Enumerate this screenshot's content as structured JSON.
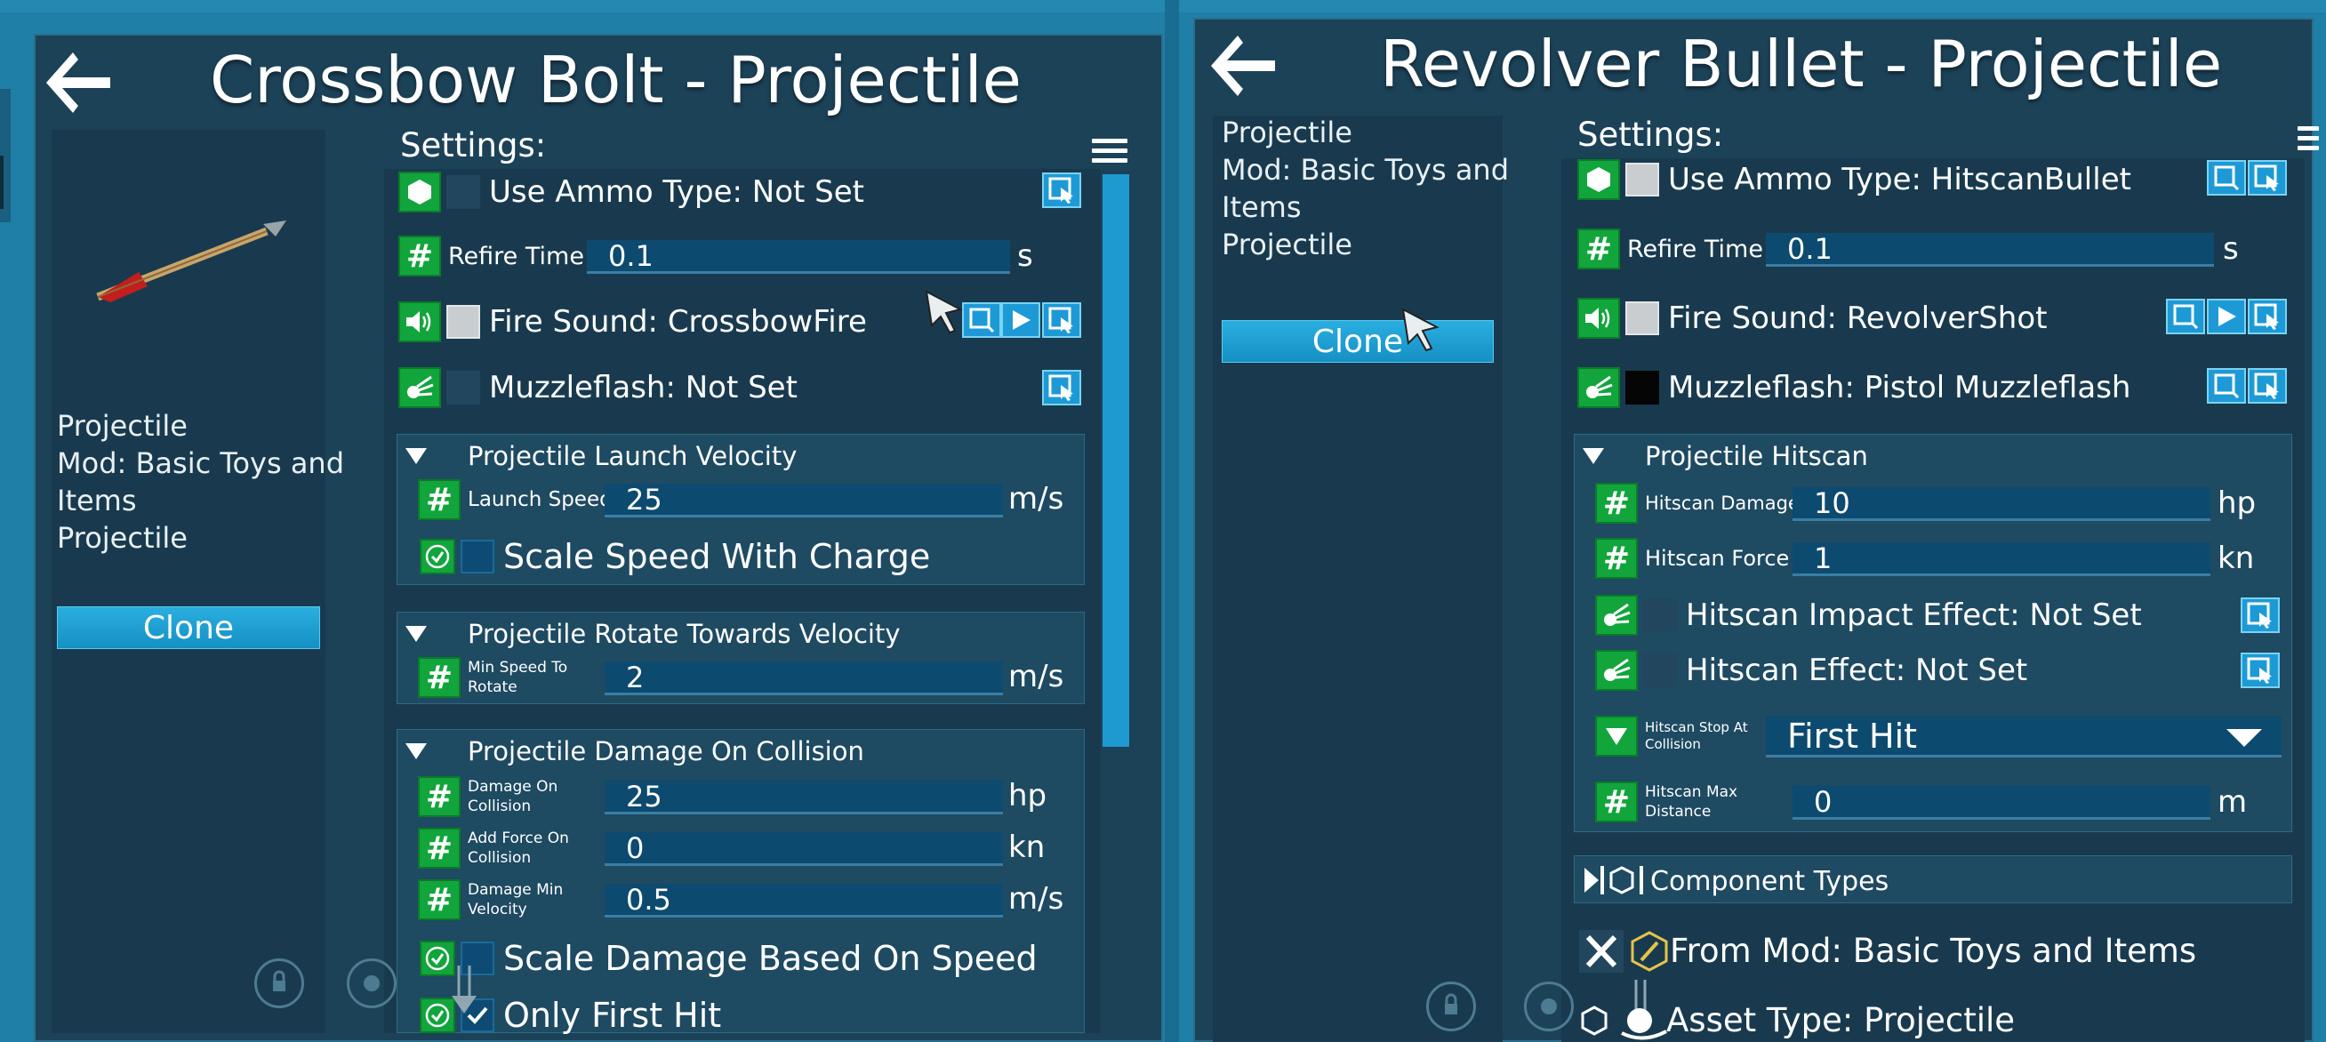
{
  "left_panel": {
    "title": "Crossbow Bolt - Projectile",
    "info_lines": [
      "Projectile",
      "Mod: Basic Toys and",
      "Items",
      "Projectile"
    ],
    "clone_label": "Clone",
    "settings_label": "Settings:",
    "rows": {
      "ammo": "Use Ammo Type: Not Set",
      "refire_label": "Refire Time",
      "refire_value": "0.1",
      "refire_unit": "s",
      "fire_sound": "Fire Sound: CrossbowFire",
      "muzzle": "Muzzleflash: Not Set"
    },
    "launch": {
      "header": "Projectile Launch Velocity",
      "speed_label": "Launch Speed",
      "speed_value": "25",
      "speed_unit": "m/s",
      "scale_label": "Scale Speed With Charge"
    },
    "rotate": {
      "header": "Projectile Rotate Towards Velocity",
      "min_label_1": "Min Speed To",
      "min_label_2": "Rotate",
      "min_value": "2",
      "min_unit": "m/s"
    },
    "damage": {
      "header": "Projectile Damage On Collision",
      "dmg_label_1": "Damage On",
      "dmg_label_2": "Collision",
      "dmg_value": "25",
      "dmg_unit": "hp",
      "force_label_1": "Add Force On",
      "force_label_2": "Collision",
      "force_value": "0",
      "force_unit": "kn",
      "minvel_label_1": "Damage Min",
      "minvel_label_2": "Velocity",
      "minvel_value": "0.5",
      "minvel_unit": "m/s",
      "scale_label": "Scale Damage Based On Speed",
      "first_hit_label": "Only First Hit"
    }
  },
  "right_panel": {
    "title": "Revolver Bullet - Projectile",
    "info_lines": [
      "Projectile",
      "Mod: Basic Toys and",
      "Items",
      "Projectile"
    ],
    "clone_label": "Clone",
    "settings_label": "Settings:",
    "rows": {
      "ammo": "Use Ammo Type: HitscanBullet",
      "refire_label": "Refire Time",
      "refire_value": "0.1",
      "refire_unit": "s",
      "fire_sound": "Fire Sound: RevolverShot",
      "muzzle": "Muzzleflash: Pistol Muzzleflash"
    },
    "hitscan": {
      "header": "Projectile Hitscan",
      "dmg_label": "Hitscan Damage",
      "dmg_value": "10",
      "dmg_unit": "hp",
      "force_label": "Hitscan Force",
      "force_value": "1",
      "force_unit": "kn",
      "impact_label": "Hitscan Impact Effect: Not Set",
      "effect_label": "Hitscan Effect: Not Set",
      "stop_label_1": "Hitscan Stop At",
      "stop_label_2": "Collision",
      "stop_value": "First Hit",
      "max_label_1": "Hitscan Max",
      "max_label_2": "Distance",
      "max_value": "0",
      "max_unit": "m"
    },
    "component_types": "Component Types",
    "from_mod": "From Mod: Basic Toys and Items",
    "asset_type": "Asset Type: Projectile"
  },
  "colors": {
    "background": "#1f7fa6",
    "panel": "#1c4258",
    "accent_green": "#11a53c",
    "button_blue": "#1d9ad6",
    "field": "#0d4a6f"
  }
}
